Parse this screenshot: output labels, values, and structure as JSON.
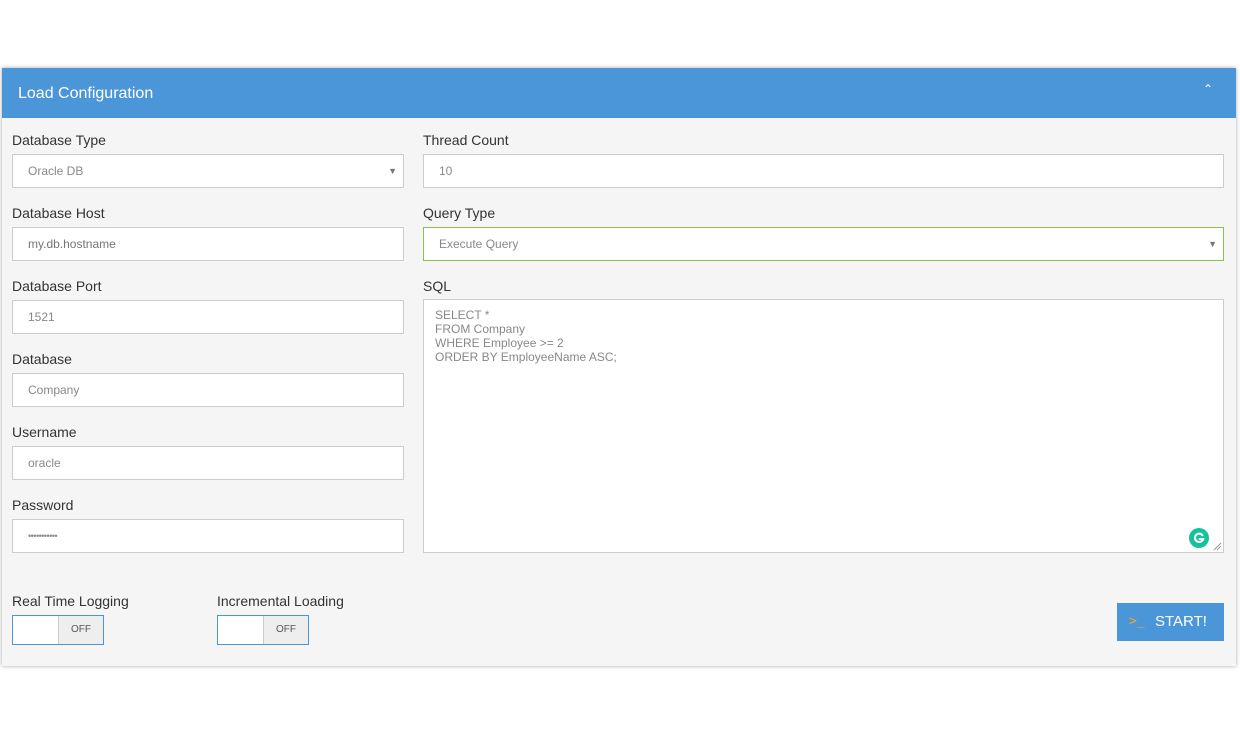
{
  "panel": {
    "title": "Load Configuration",
    "collapse_icon": "chevron-up-icon"
  },
  "left": {
    "database_type": {
      "label": "Database Type",
      "value": "Oracle DB"
    },
    "database_host": {
      "label": "Database Host",
      "placeholder": "my.db.hostname"
    },
    "database_port": {
      "label": "Database Port",
      "value": "1521"
    },
    "database": {
      "label": "Database",
      "value": "Company"
    },
    "username": {
      "label": "Username",
      "value": "oracle"
    },
    "password": {
      "label": "Password",
      "value": "•••••••••••"
    }
  },
  "right": {
    "thread_count": {
      "label": "Thread Count",
      "value": "10"
    },
    "query_type": {
      "label": "Query Type",
      "value": "Execute Query"
    },
    "sql": {
      "label": "SQL",
      "lines": [
        "SELECT *",
        "FROM Company",
        "WHERE Employee >= 2",
        "ORDER BY EmployeeName ASC;"
      ]
    }
  },
  "toggles": {
    "real_time_logging": {
      "label": "Real Time Logging",
      "state": "OFF"
    },
    "incremental_loading": {
      "label": "Incremental Loading",
      "state": "OFF"
    }
  },
  "start_button": {
    "icon": ">_",
    "label": "START!"
  },
  "colors": {
    "accent": "#4a96d8",
    "active_border": "#8bc34a",
    "icon_orange": "#f5a623",
    "grammarly_green": "#15c39a"
  }
}
